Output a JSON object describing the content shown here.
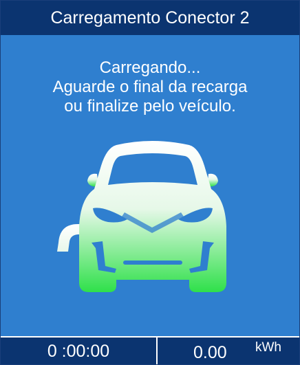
{
  "header": {
    "title": "Carregamento Conector 2"
  },
  "message": {
    "lines": [
      "Carregando...",
      "Aguarde o final da recarga",
      "ou finalize pelo veículo."
    ]
  },
  "illustration": {
    "icon": "electric-car-charging-icon"
  },
  "footer": {
    "elapsed_time": "0 :00:00",
    "energy_value": "0.00",
    "energy_unit": "kWh"
  },
  "colors": {
    "header_bg": "#0b3470",
    "screen_bg": "#2f7fcf",
    "car_gradient_top": "#ffffff",
    "car_gradient_bottom": "#2fe04a"
  }
}
